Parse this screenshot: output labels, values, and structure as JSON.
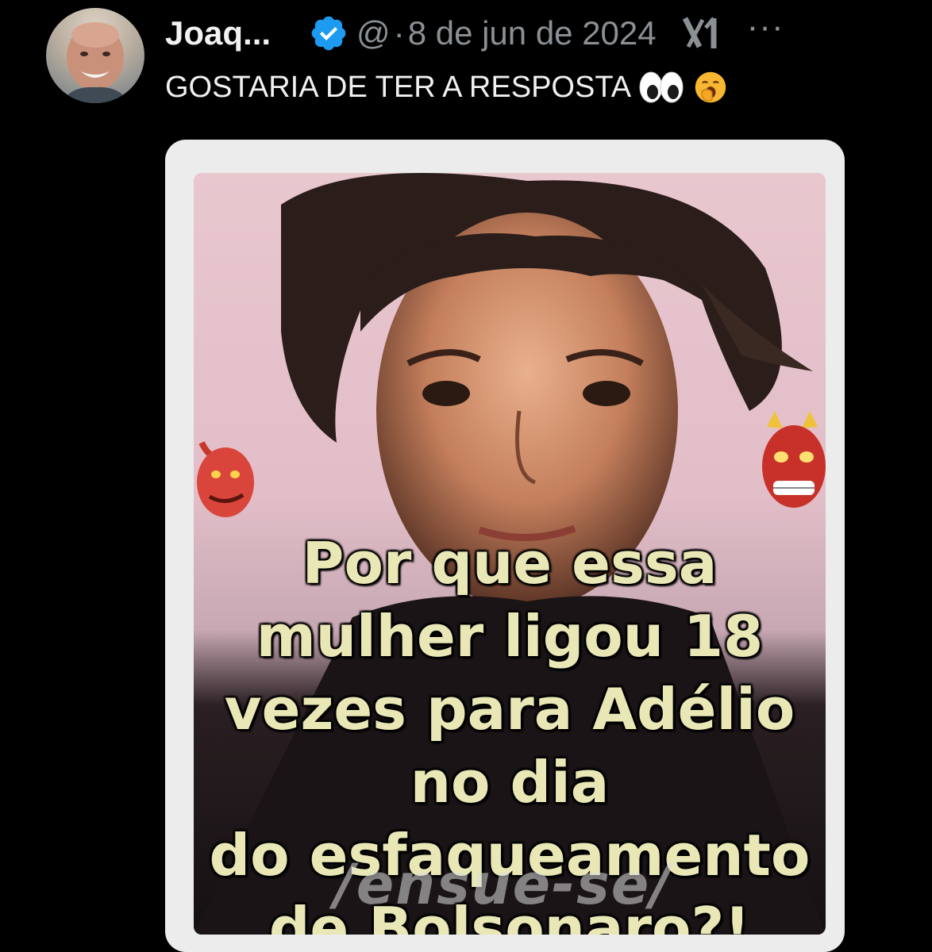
{
  "post": {
    "author_name": "Joaq...",
    "handle": "@",
    "separator": "·",
    "date": "8 de jun de 2024",
    "more_label": "···",
    "text": "GOSTARIA DE TER A RESPOSTA",
    "emojis": [
      "eyes-emoji",
      "yawning-face-emoji"
    ]
  },
  "icons": {
    "verified": "verified-badge-icon",
    "grok": "grok-icon",
    "more": "more-options-icon"
  },
  "colors": {
    "background": "#000000",
    "verified_blue": "#1d9bf0",
    "secondary_text": "#8b9095",
    "caption_text": "#e9e7b5"
  },
  "media": {
    "caption_lines": [
      "Por que essa",
      "mulher ligou 18",
      "vezes para Adélio",
      "no dia",
      "do esfaqueamento",
      "de Bolsonaro?!"
    ],
    "watermark": "/ensue-se/"
  }
}
